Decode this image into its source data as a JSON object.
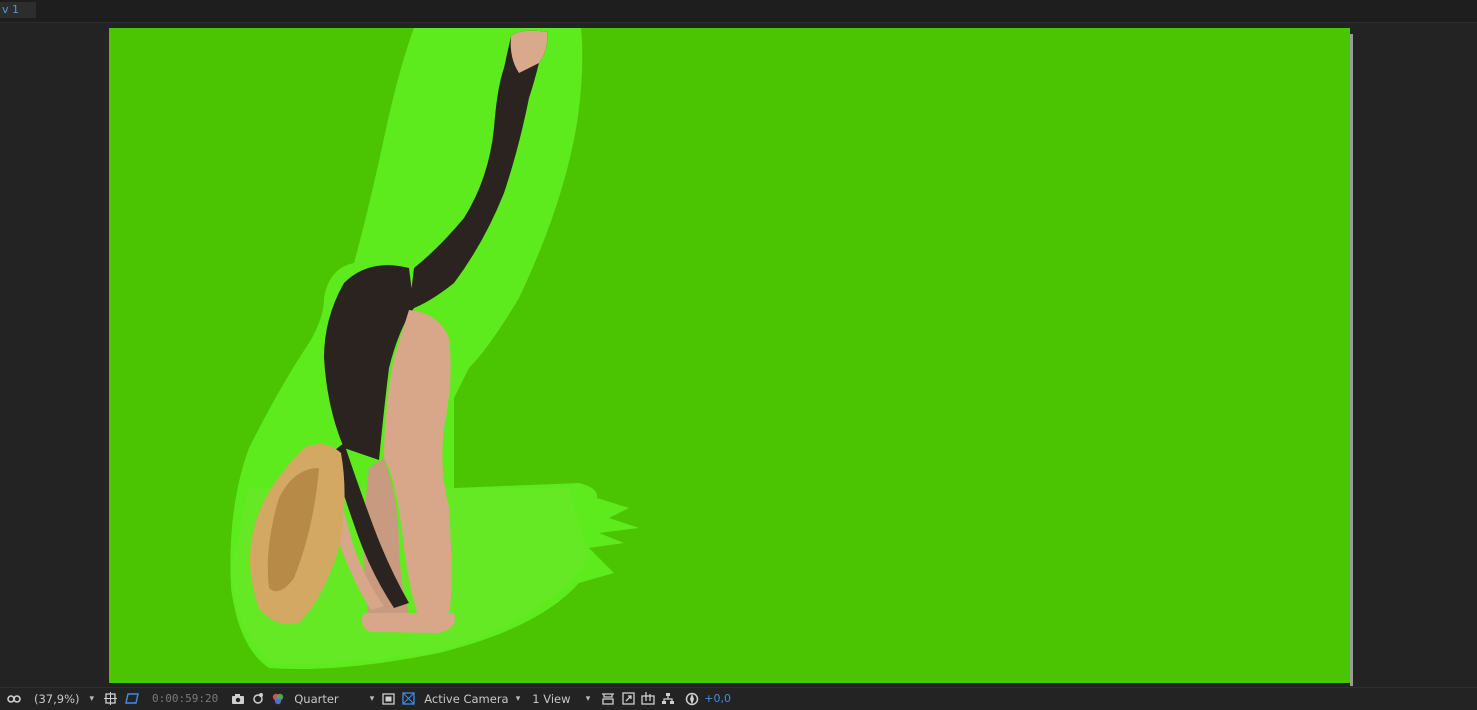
{
  "tab": {
    "label": "v 1"
  },
  "viewer": {
    "background_color": "#4bc402",
    "mask_color": "#5ff021",
    "content": "green-screen-composition"
  },
  "bottombar": {
    "zoom_label": "(37,9%)",
    "timecode": "0:00:59:20",
    "resolution": "Quarter",
    "camera": "Active Camera",
    "views": "1 View",
    "exposure": "+0,0"
  },
  "icons": {
    "mask": "mask-icon",
    "grid": "grid-icon",
    "region": "region-of-interest-icon",
    "snapshot": "camera-snapshot-icon",
    "show_snapshot": "show-snapshot-icon",
    "channels": "color-channels-icon",
    "fast_preview": "fast-preview-icon",
    "transparency": "transparency-grid-icon",
    "layout": "layout-icon",
    "reset_exposure": "reset-exposure-icon",
    "flowchart": "flowchart-icon",
    "timeline": "timeline-icon"
  }
}
